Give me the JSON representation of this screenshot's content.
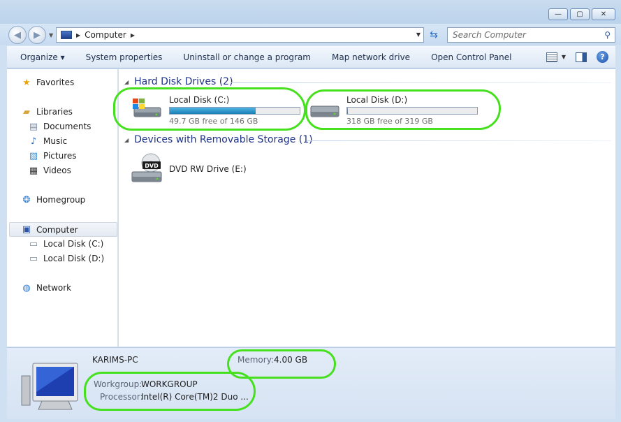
{
  "window": {
    "minimize_glyph": "—",
    "maximize_glyph": "▢",
    "close_glyph": "✕"
  },
  "address": {
    "location": "Computer",
    "search_placeholder": "Search Computer"
  },
  "toolbar": {
    "organize": "Organize ▾",
    "system_properties": "System properties",
    "uninstall": "Uninstall or change a program",
    "map_drive": "Map network drive",
    "control_panel": "Open Control Panel"
  },
  "nav": {
    "favorites": "Favorites",
    "libraries": "Libraries",
    "documents": "Documents",
    "music": "Music",
    "pictures": "Pictures",
    "videos": "Videos",
    "homegroup": "Homegroup",
    "computer": "Computer",
    "local_c": "Local Disk (C:)",
    "local_d": "Local Disk (D:)",
    "network": "Network"
  },
  "groups": {
    "hard_disk": "Hard Disk Drives (2)",
    "removable": "Devices with Removable Storage (1)"
  },
  "drives": {
    "c": {
      "name": "Local Disk (C:)",
      "free": "49.7 GB free of 146 GB",
      "used_fraction": 0.66
    },
    "d": {
      "name": "Local Disk (D:)",
      "free": "318 GB free of 319 GB",
      "used_fraction": 0.003
    },
    "e": {
      "name": "DVD RW Drive (E:)",
      "badge": "DVD"
    }
  },
  "details": {
    "pc_name": "KARIMS-PC",
    "memory_label": "Memory:",
    "memory_value": "4.00 GB",
    "workgroup_label": "Workgroup:",
    "workgroup_value": "WORKGROUP",
    "processor_label": "Processor:",
    "processor_value": "Intel(R) Core(TM)2 Duo ..."
  },
  "colors": {
    "highlight": "#46e01f",
    "group_heading": "#1e3287",
    "bar_fill": "#1b7fb8"
  }
}
